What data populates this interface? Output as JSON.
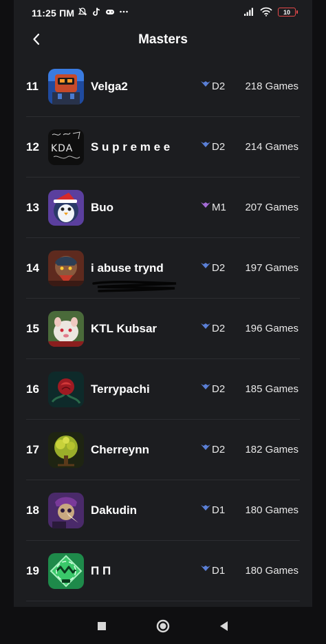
{
  "status_bar": {
    "time": "11:25 ПМ",
    "battery": "10",
    "icons_left": [
      "mute-icon",
      "tiktok-icon",
      "controller-icon",
      "more-icon"
    ],
    "icons_right": [
      "signal-icon",
      "wifi-icon",
      "battery-icon"
    ]
  },
  "header": {
    "title": "Masters",
    "back_icon": "chevron-left-icon"
  },
  "players": [
    {
      "rank": "11",
      "name": "Velga2",
      "tier": "D2",
      "tier_color": "#5a7fd6",
      "games": "218 Games",
      "avatar": "robot"
    },
    {
      "rank": "12",
      "name": "S u p r e m e e",
      "tier": "D2",
      "tier_color": "#5a7fd6",
      "games": "214 Games",
      "avatar": "kda"
    },
    {
      "rank": "13",
      "name": "Buo",
      "tier": "M1",
      "tier_color": "#a46bd6",
      "games": "207 Games",
      "avatar": "penguin"
    },
    {
      "rank": "14",
      "name": "i abuse trynd",
      "tier": "D2",
      "tier_color": "#5a7fd6",
      "games": "197 Games",
      "avatar": "warrior"
    },
    {
      "rank": "15",
      "name": "KTL Kubsar",
      "tier": "D2",
      "tier_color": "#5a7fd6",
      "games": "196 Games",
      "avatar": "poro"
    },
    {
      "rank": "16",
      "name": "Terrypachi",
      "tier": "D2",
      "tier_color": "#5a7fd6",
      "games": "185 Games",
      "avatar": "rose"
    },
    {
      "rank": "17",
      "name": "Cherreynn",
      "tier": "D2",
      "tier_color": "#5a7fd6",
      "games": "182 Games",
      "avatar": "tree"
    },
    {
      "rank": "18",
      "name": "Dakudin",
      "tier": "D1",
      "tier_color": "#5a7fd6",
      "games": "180 Games",
      "avatar": "plague"
    },
    {
      "rank": "19",
      "name": "П П",
      "tier": "D1",
      "tier_color": "#5a7fd6",
      "games": "180 Games",
      "avatar": "emblem"
    }
  ],
  "nav_bar": {
    "buttons": [
      "recent-apps-icon",
      "home-icon",
      "back-icon"
    ]
  }
}
